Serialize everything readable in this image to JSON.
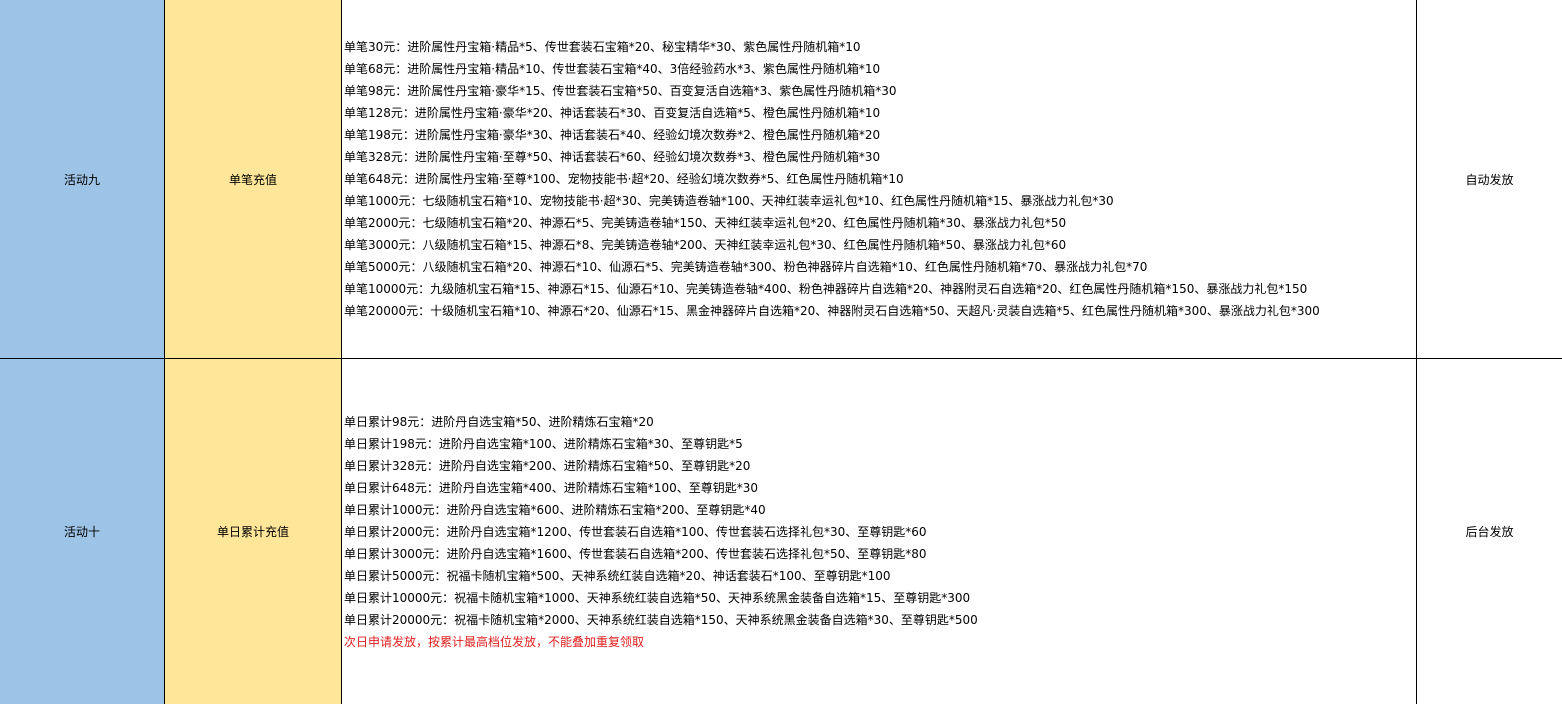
{
  "colors": {
    "activity_col": "#9dc3e6",
    "type_col": "#ffe699",
    "note_text": "#e02020",
    "top_accent": "#1f9e5f"
  },
  "rows": [
    {
      "activity": "活动九",
      "type": "单笔充值",
      "rewards": [
        "单笔30元：进阶属性丹宝箱·精品*5、传世套装石宝箱*20、秘宝精华*30、紫色属性丹随机箱*10",
        "单笔68元：进阶属性丹宝箱·精品*10、传世套装石宝箱*40、3倍经验药水*3、紫色属性丹随机箱*10",
        "单笔98元：进阶属性丹宝箱·豪华*15、传世套装石宝箱*50、百变复活自选箱*3、紫色属性丹随机箱*30",
        "单笔128元：进阶属性丹宝箱·豪华*20、神话套装石*30、百变复活自选箱*5、橙色属性丹随机箱*10",
        "单笔198元：进阶属性丹宝箱·豪华*30、神话套装石*40、经验幻境次数券*2、橙色属性丹随机箱*20",
        "单笔328元：进阶属性丹宝箱·至尊*50、神话套装石*60、经验幻境次数券*3、橙色属性丹随机箱*30",
        "单笔648元：进阶属性丹宝箱·至尊*100、宠物技能书·超*20、经验幻境次数券*5、红色属性丹随机箱*10",
        "单笔1000元：七级随机宝石箱*10、宠物技能书·超*30、完美铸造卷轴*100、天神红装幸运礼包*10、红色属性丹随机箱*15、暴涨战力礼包*30",
        "单笔2000元：七级随机宝石箱*20、神源石*5、完美铸造卷轴*150、天神红装幸运礼包*20、红色属性丹随机箱*30、暴涨战力礼包*50",
        "单笔3000元：八级随机宝石箱*15、神源石*8、完美铸造卷轴*200、天神红装幸运礼包*30、红色属性丹随机箱*50、暴涨战力礼包*60",
        "单笔5000元：八级随机宝石箱*20、神源石*10、仙源石*5、完美铸造卷轴*300、粉色神器碎片自选箱*10、红色属性丹随机箱*70、暴涨战力礼包*70",
        "单笔10000元：九级随机宝石箱*15、神源石*15、仙源石*10、完美铸造卷轴*400、粉色神器碎片自选箱*20、神器附灵石自选箱*20、红色属性丹随机箱*150、暴涨战力礼包*150",
        "单笔20000元：十级随机宝石箱*10、神源石*20、仙源石*15、黑金神器碎片自选箱*20、神器附灵石自选箱*50、天超凡·灵装自选箱*5、红色属性丹随机箱*300、暴涨战力礼包*300"
      ],
      "note": "",
      "method": "自动发放"
    },
    {
      "activity": "活动十",
      "type": "单日累计充值",
      "rewards": [
        "单日累计98元：进阶丹自选宝箱*50、进阶精炼石宝箱*20",
        "单日累计198元：进阶丹自选宝箱*100、进阶精炼石宝箱*30、至尊钥匙*5",
        "单日累计328元：进阶丹自选宝箱*200、进阶精炼石宝箱*50、至尊钥匙*20",
        "单日累计648元：进阶丹自选宝箱*400、进阶精炼石宝箱*100、至尊钥匙*30",
        "单日累计1000元：进阶丹自选宝箱*600、进阶精炼石宝箱*200、至尊钥匙*40",
        "单日累计2000元：进阶丹自选宝箱*1200、传世套装石自选箱*100、传世套装石选择礼包*30、至尊钥匙*60",
        "单日累计3000元：进阶丹自选宝箱*1600、传世套装石自选箱*200、传世套装石选择礼包*50、至尊钥匙*80",
        "单日累计5000元：祝福卡随机宝箱*500、天神系统红装自选箱*20、神话套装石*100、至尊钥匙*100",
        "单日累计10000元：祝福卡随机宝箱*1000、天神系统红装自选箱*50、天神系统黑金装备自选箱*15、至尊钥匙*300",
        "单日累计20000元：祝福卡随机宝箱*2000、天神系统红装自选箱*150、天神系统黑金装备自选箱*30、至尊钥匙*500"
      ],
      "note": "次日申请发放，按累计最高档位发放，不能叠加重复领取",
      "method": "后台发放"
    }
  ]
}
